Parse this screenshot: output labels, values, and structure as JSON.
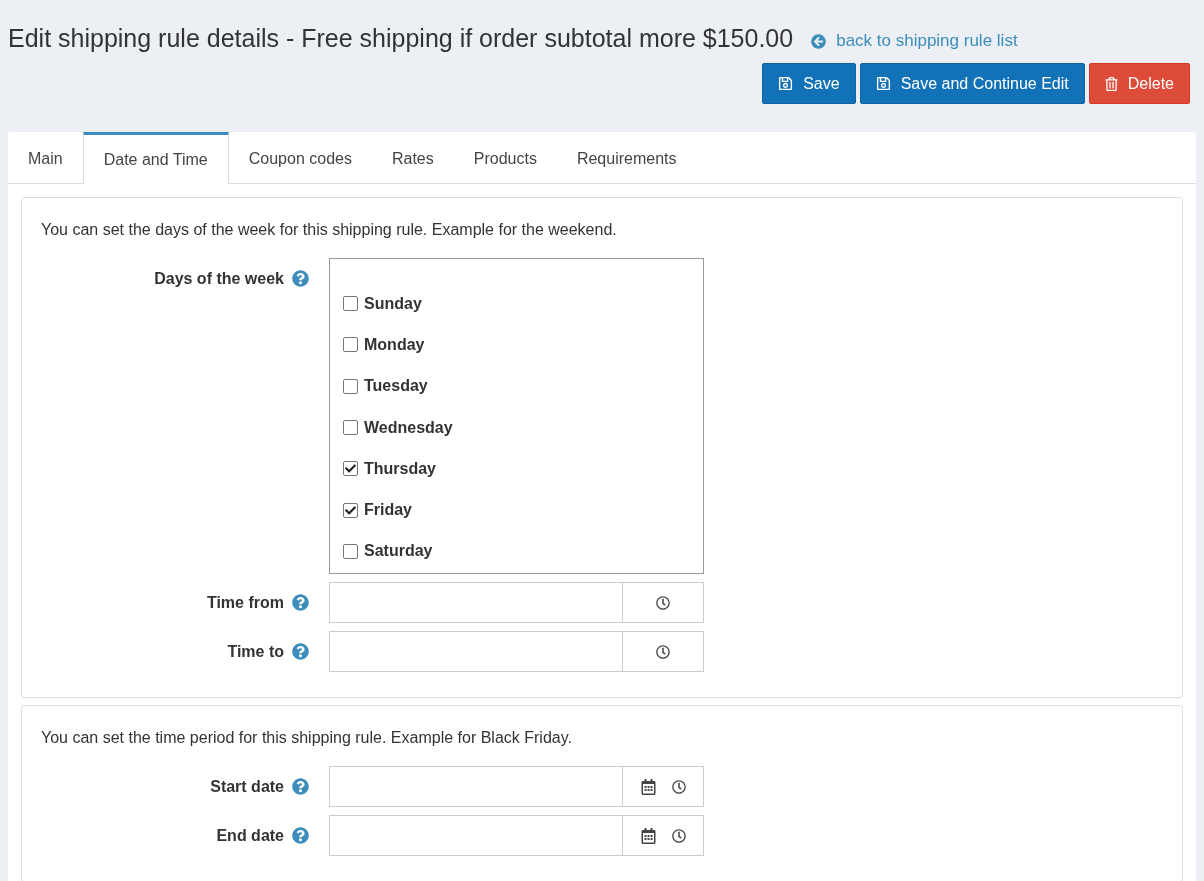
{
  "title": "Edit shipping rule details - Free shipping if order subtotal more $150.00",
  "back_link": "back to shipping rule list",
  "buttons": [
    {
      "label": "Save",
      "kind": "primary"
    },
    {
      "label": "Save and Continue Edit",
      "kind": "primary"
    },
    {
      "label": "Delete",
      "kind": "danger"
    }
  ],
  "tabs": [
    {
      "label": "Main",
      "selected": false
    },
    {
      "label": "Date and Time",
      "selected": true
    },
    {
      "label": "Coupon codes",
      "selected": false
    },
    {
      "label": "Rates",
      "selected": false
    },
    {
      "label": "Products",
      "selected": false
    },
    {
      "label": "Requirements",
      "selected": false
    }
  ],
  "sections": [
    {
      "description": "You can set the days of the week for this shipping rule. Example for the weekend.",
      "fields": [
        {
          "label": "Days of the week",
          "kind": "checklist",
          "options": [
            {
              "label": "Sunday",
              "checked": false
            },
            {
              "label": "Monday",
              "checked": false
            },
            {
              "label": "Tuesday",
              "checked": false
            },
            {
              "label": "Wednesday",
              "checked": false
            },
            {
              "label": "Thursday",
              "checked": true
            },
            {
              "label": "Friday",
              "checked": true
            },
            {
              "label": "Saturday",
              "checked": false
            }
          ]
        },
        {
          "label": "Time from",
          "kind": "time"
        },
        {
          "label": "Time to",
          "kind": "time"
        }
      ]
    },
    {
      "description": "You can set the time period for this shipping rule. Example for Black Friday.",
      "fields": [
        {
          "label": "Start date",
          "kind": "datetime"
        },
        {
          "label": "End date",
          "kind": "datetime"
        }
      ]
    }
  ]
}
